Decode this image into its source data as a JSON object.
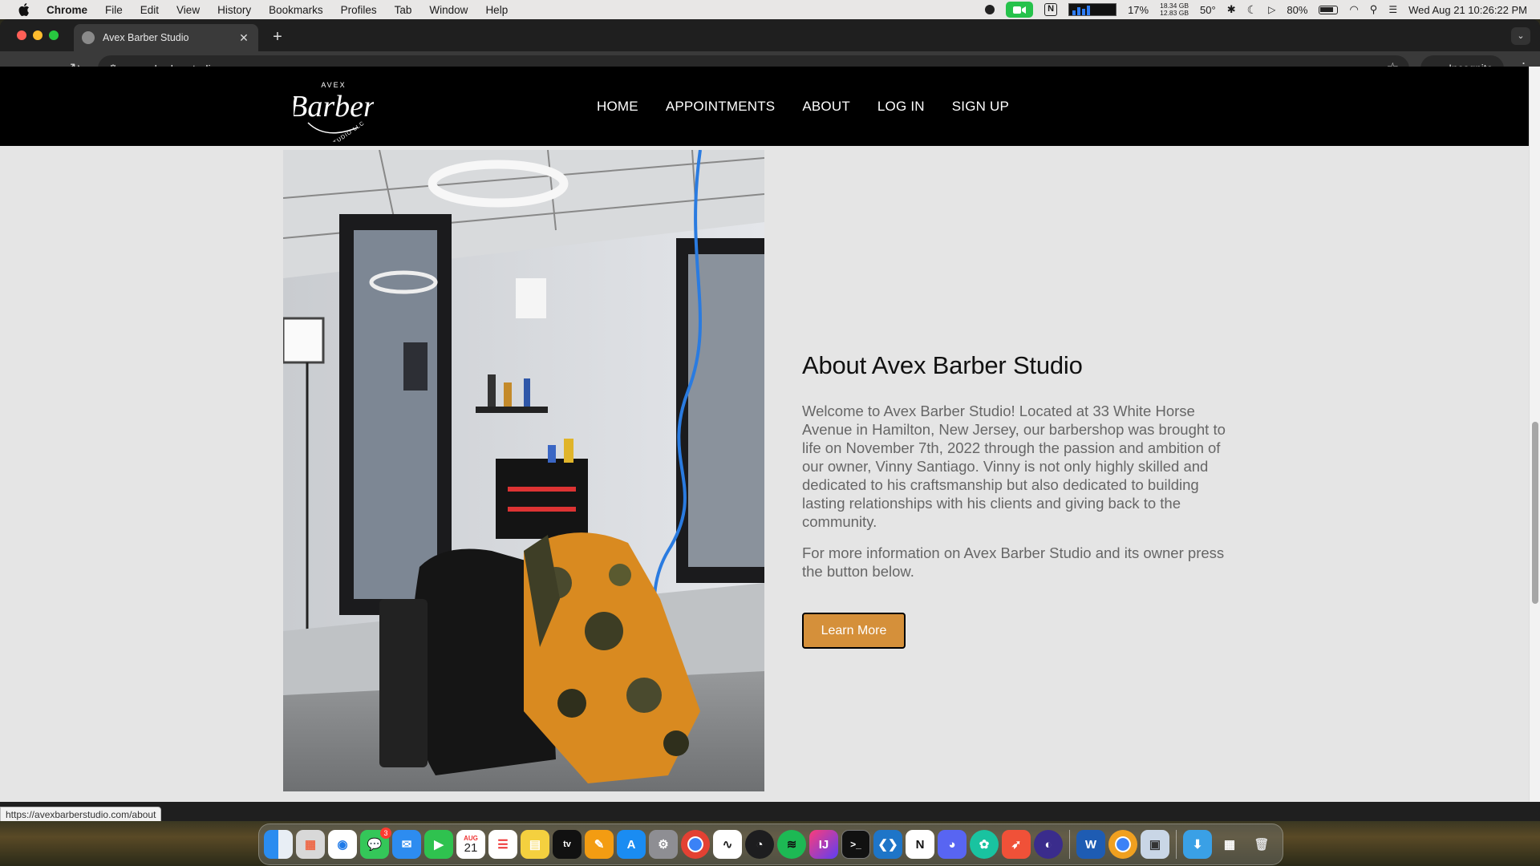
{
  "menubar": {
    "app_name": "Chrome",
    "items": [
      "File",
      "Edit",
      "View",
      "History",
      "Bookmarks",
      "Profiles",
      "Tab",
      "Window",
      "Help"
    ],
    "cpu": "17%",
    "disk_used": "18.34 GB",
    "disk_free": "12.83 GB",
    "temperature": "50°",
    "battery": "80%",
    "datetime": "Wed Aug 21  10:26:22 PM"
  },
  "browser": {
    "tab_title": "Avex Barber Studio",
    "url": "avexbarberstudio.com",
    "incognito_label": "Incognito",
    "status_url": "https://avexbarberstudio.com/about"
  },
  "site": {
    "logo_top": "AVEX",
    "logo_main": "Barber",
    "logo_bottom": "STUDIO LLC",
    "nav": [
      "HOME",
      "APPOINTMENTS",
      "ABOUT",
      "LOG IN",
      "SIGN UP"
    ],
    "about": {
      "title": "About Avex Barber Studio",
      "paragraph1": "Welcome to Avex Barber Studio! Located at 33 White Horse Avenue in Hamilton, New Jersey, our barbershop was brought to life on November 7th, 2022 through the passion and ambition of our owner, Vinny Santiago. Vinny is not only highly skilled and dedicated to his craftsmanship but also dedicated to building lasting relationships with his clients and giving back to the community.",
      "paragraph2": "For more information on Avex Barber Studio and its owner press the button below.",
      "button_label": "Learn More",
      "button_color": "#d5903a"
    }
  },
  "dock": {
    "messages_badge": "3",
    "calendar_month": "AUG",
    "calendar_day": "21",
    "tv_label": "tv"
  }
}
